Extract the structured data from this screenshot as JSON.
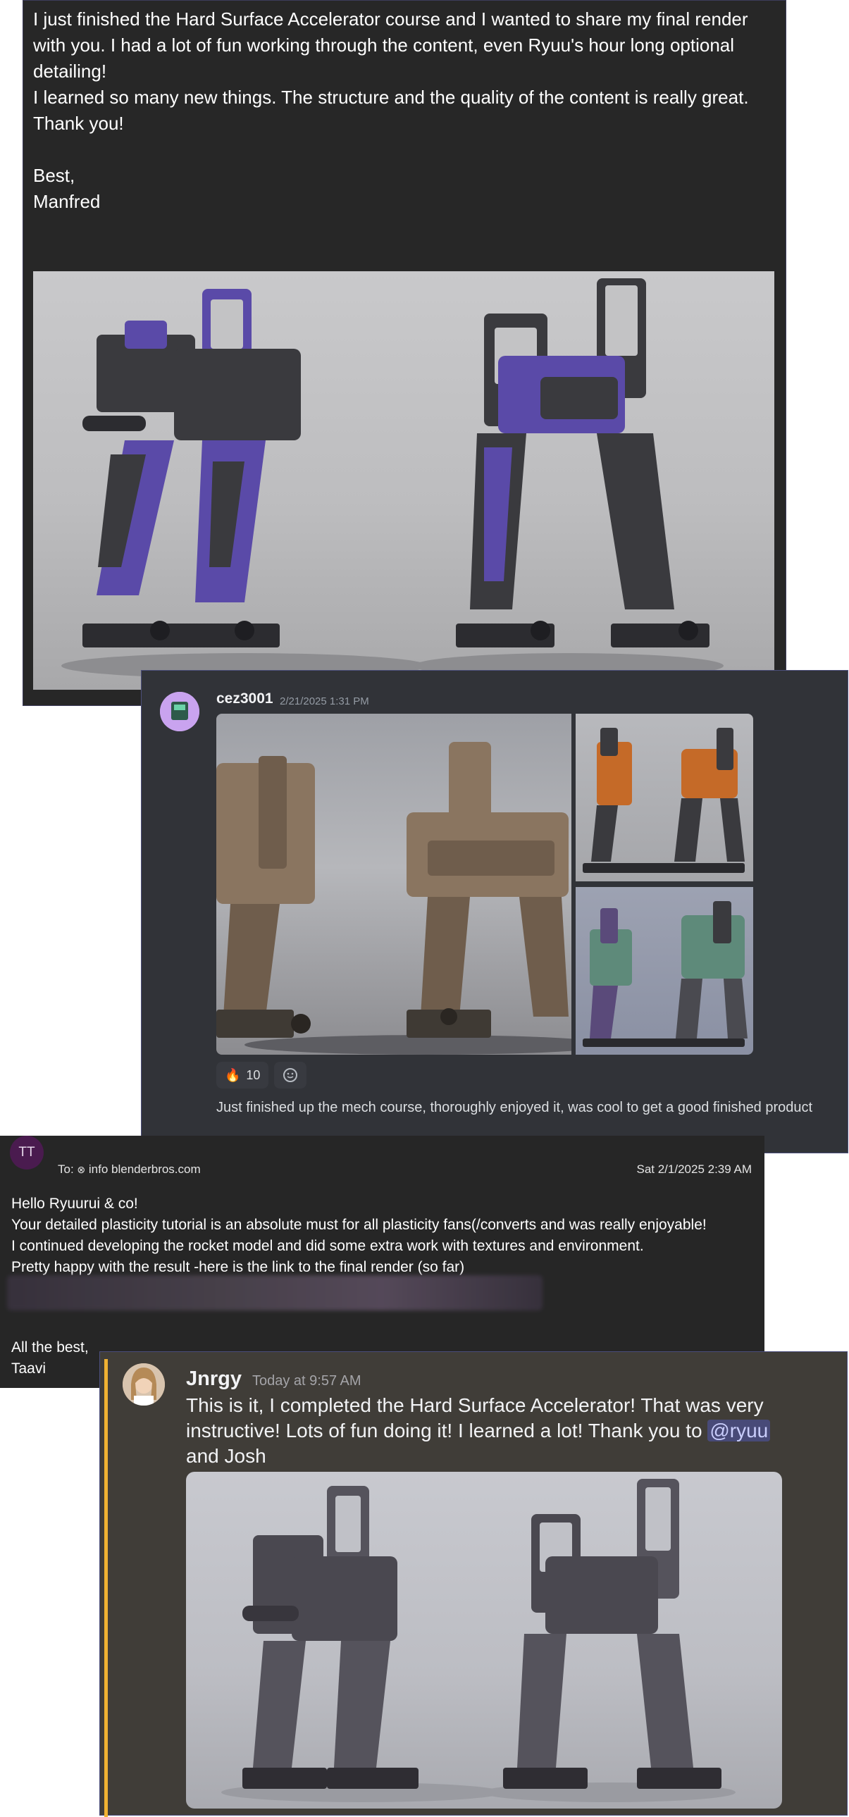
{
  "email1": {
    "paragraphs": [
      "I just finished the Hard Surface Accelerator course and I wanted to share my final render with you. I had a lot of fun working through the content, even Ryuu's hour long optional detailing!",
      "I learned so many new things. The structure and the quality of the content is really great.",
      "Thank you!",
      " ",
      "Best,",
      "Manfred"
    ]
  },
  "discord1": {
    "username": "cez3001",
    "timestamp": "2/21/2025 1:31 PM",
    "reactions": [
      {
        "emoji": "🔥",
        "count": "10"
      },
      {
        "emoji": "add-reaction-icon",
        "count": ""
      }
    ],
    "message": "Just finished up the mech course, thoroughly enjoyed it, was cool to get a good finished product"
  },
  "email2": {
    "avatar_initials": "TT",
    "to_label": "To:",
    "to_address": "info blenderbros.com",
    "date": "Sat 2/1/2025 2:39 AM",
    "paragraphs": [
      "Hello Ryuurui & co!",
      "Your detailed plasticity tutorial is an absolute must for all plasticity fans(/converts and was really enjoyable!",
      "I continued developing the rocket model and did some extra work with textures and environment.",
      "Pretty happy with the result -here is the link to the final render (so far)"
    ],
    "closing": [
      "All the best,",
      "Taavi"
    ]
  },
  "discord2": {
    "username": "Jnrgy",
    "timestamp": "Today at 9:57 AM",
    "message_before": "This is it, I completed the Hard Surface Accelerator! That was very instructive! Lots of fun doing it! I learned a lot! Thank you to ",
    "mention": "@ryuu",
    "message_after": " and Josh",
    "accent_color": "#f0b232"
  },
  "colors": {
    "mech_purple": "#5a4aa8",
    "mech_dark": "#3a3a3e",
    "mech_tan": "#8a7560",
    "mech_orange": "#c56a28",
    "mech_green": "#5e8a7a"
  }
}
